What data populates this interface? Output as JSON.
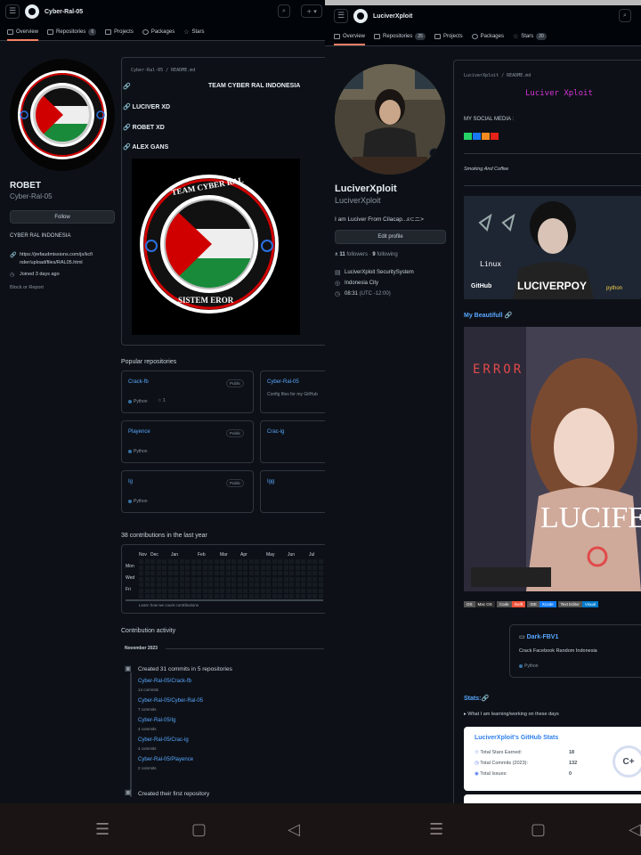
{
  "left": {
    "topbar_title": "Cyber-Ral-05",
    "tabs": {
      "overview": "Overview",
      "repositories": "Repositories",
      "repo_count": "6",
      "projects": "Projects",
      "packages": "Packages",
      "stars": "Stars"
    },
    "profile": {
      "name": "ROBET",
      "username": "Cyber-Ral-05",
      "follow": "Follow",
      "bio": "CYBER RAL INDONESIA",
      "link": "https://jrefaudmissions.com/js/kcfinder/upload/files/RAL05.html",
      "link_l1": "https://jrefaudmissions.com/js/kcfi",
      "link_l2": "nder/upload/files/RAL05.html",
      "joined": "Joined 3 days ago",
      "block": "Block or Report"
    },
    "readme": {
      "path": "Cyber-Ral-05 / README.md",
      "heading": "TEAM CYBER RAL INDONESIA",
      "members": [
        "LUCIVER XD",
        "ROBET XD",
        "ALEX GANS"
      ],
      "emblem_top": "TEAM CYBER RAL",
      "emblem_bottom": "SISTEM EROR"
    },
    "popular_title": "Popular repositories",
    "repos": [
      {
        "name": "Crack-fb",
        "badge": "Public",
        "lang": "Python",
        "stars": "1",
        "desc": ""
      },
      {
        "name": "Cyber-Ral-05",
        "badge": "",
        "lang": "",
        "stars": "",
        "desc": "Config files for my GitHub"
      },
      {
        "name": "Playence",
        "badge": "Public",
        "lang": "Python",
        "stars": "",
        "desc": ""
      },
      {
        "name": "Crac-ig",
        "badge": "",
        "lang": "",
        "stars": "",
        "desc": ""
      },
      {
        "name": "Ig",
        "badge": "Public",
        "lang": "Python",
        "stars": "",
        "desc": ""
      },
      {
        "name": "Igg",
        "badge": "",
        "lang": "",
        "stars": "",
        "desc": ""
      }
    ],
    "contrib_title": "38 contributions in the last year",
    "months": [
      "Nov",
      "Dec",
      "Jan",
      "Feb",
      "Mar",
      "Apr",
      "May",
      "Jun",
      "Jul"
    ],
    "days": [
      "Mon",
      "Wed",
      "Fri"
    ],
    "contrib_learn": "Learn how we count contributions",
    "activity_title": "Contribution activity",
    "activity_month": "November 2023",
    "activity_created": "Created 31 commits in 5 repositories",
    "activity_repos": [
      {
        "name": "Cyber-Ral-05/Crack-fb",
        "commits": "14 commits"
      },
      {
        "name": "Cyber-Ral-05/Cyber-Ral-05",
        "commits": "7 commits"
      },
      {
        "name": "Cyber-Ral-05/Ig",
        "commits": "4 commits"
      },
      {
        "name": "Cyber-Ral-05/Crac-ig",
        "commits": "4 commits"
      },
      {
        "name": "Cyber-Ral-05/Playence",
        "commits": "2 commits"
      }
    ],
    "activity_first": "Created their first repository"
  },
  "right": {
    "topbar_title": "LuciverXploit",
    "tabs": {
      "overview": "Overview",
      "repositories": "Repositories",
      "repo_count": "25",
      "projects": "Projects",
      "packages": "Packages",
      "stars": "Stars",
      "star_count": "20"
    },
    "profile": {
      "name": "LuciverXploit",
      "username": "LuciverXploit",
      "bio": "I am Luciver From Cilacap...ε⊂ニ>",
      "edit": "Edit profile",
      "followers": "11",
      "followers_label": "followers",
      "following": "9",
      "following_label": "following",
      "org": "LuciverXploit SecuritySystem",
      "location": "Indonesia City",
      "time": "08:31",
      "tz": "(UTC -12:00)"
    },
    "readme": {
      "path": "LuciverXploit / README.md",
      "title": "Luciver Xploit",
      "social": "MY SOCIAL MEDIA :",
      "tagline": "Smoking And Coffee",
      "banner_text1": "Linux",
      "banner_text2": "LUCIVERPOY",
      "github": "GitHub",
      "python": "python",
      "beautiful": "My Beautifull",
      "error_text": "ERROR",
      "lucifer_text": "LUCIFE",
      "badges": [
        "OS",
        "Mac OS",
        "Code",
        "Swift",
        "IDE",
        "Xcode",
        "Text Editor",
        "Visual"
      ],
      "pinned": {
        "name": "Dark-FBV1",
        "desc": "Crack Facebook Random Indonesia",
        "lang": "Python"
      },
      "stats_title": "Stats:",
      "learning": "▸ What I am learning/working on these days",
      "stats": {
        "title": "LuciverXploit's GitHub Stats",
        "rows": [
          {
            "label": "Total Stars Earned:",
            "value": "18"
          },
          {
            "label": "Total Commits (2023):",
            "value": "132"
          },
          {
            "label": "Total Issues:",
            "value": "0"
          }
        ],
        "grade": "C+"
      }
    }
  },
  "colors": {
    "accent": "#f78166",
    "link": "#58a6ff",
    "bg": "#0d1117",
    "python": "#3572a5"
  }
}
